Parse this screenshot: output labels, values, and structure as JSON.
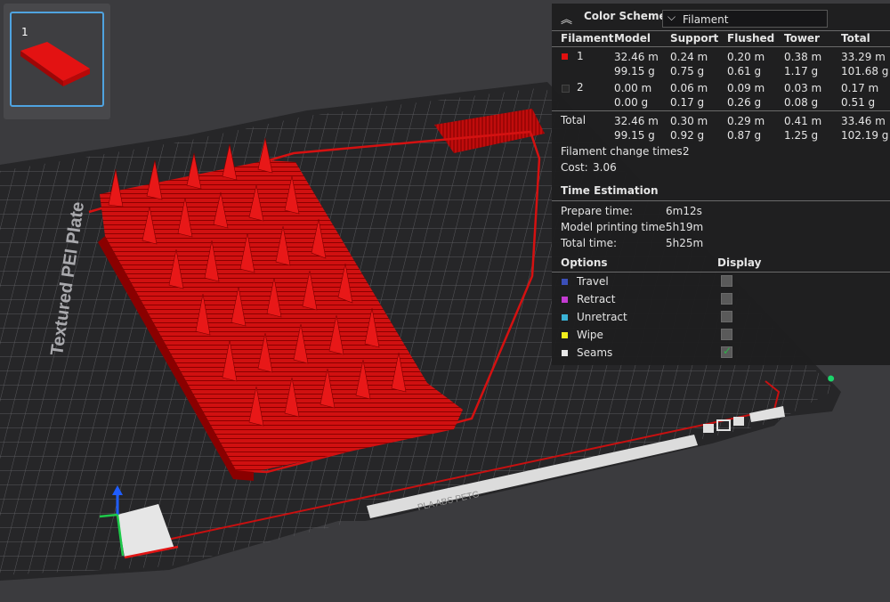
{
  "plate": {
    "label": "Textured PEI Plate",
    "bottom_label": "PLA ABS PETG"
  },
  "thumbnail": {
    "number": "1"
  },
  "panel": {
    "color_scheme_label": "Color Scheme",
    "color_scheme_value": "Filament",
    "columns": [
      "Filament",
      "Model",
      "Support",
      "Flushed",
      "Tower",
      "Total"
    ],
    "rows": [
      {
        "id": "1",
        "color": "#e11010",
        "model": [
          "32.46 m",
          "99.15 g"
        ],
        "support": [
          "0.24 m",
          "0.75 g"
        ],
        "flushed": [
          "0.20 m",
          "0.61 g"
        ],
        "tower": [
          "0.38 m",
          "1.17 g"
        ],
        "total": [
          "33.29 m",
          "101.68 g"
        ]
      },
      {
        "id": "2",
        "color": "#2a2a2a",
        "model": [
          "0.00 m",
          "0.00 g"
        ],
        "support": [
          "0.06 m",
          "0.17 g"
        ],
        "flushed": [
          "0.09 m",
          "0.26 g"
        ],
        "tower": [
          "0.03 m",
          "0.08 g"
        ],
        "total": [
          "0.17 m",
          "0.51 g"
        ]
      }
    ],
    "total_row": {
      "label": "Total",
      "model": [
        "32.46 m",
        "99.15 g"
      ],
      "support": [
        "0.30 m",
        "0.92 g"
      ],
      "flushed": [
        "0.29 m",
        "0.87 g"
      ],
      "tower": [
        "0.41 m",
        "1.25 g"
      ],
      "total": [
        "33.46 m",
        "102.19 g"
      ]
    },
    "filament_change_label": "Filament change times:",
    "filament_change_value": "2",
    "cost_label": "Cost:",
    "cost_value": "3.06",
    "time_estimation_title": "Time Estimation",
    "times": [
      {
        "label": "Prepare time:",
        "value": "6m12s"
      },
      {
        "label": "Model printing time:",
        "value": "5h19m"
      },
      {
        "label": "Total time:",
        "value": "5h25m"
      }
    ],
    "options_header": "Options",
    "display_header": "Display",
    "options": [
      {
        "label": "Travel",
        "color": "#3b4fb8",
        "checked": false
      },
      {
        "label": "Retract",
        "color": "#c43bd2",
        "checked": false
      },
      {
        "label": "Unretract",
        "color": "#3ab2d6",
        "checked": false
      },
      {
        "label": "Wipe",
        "color": "#f2ee1c",
        "checked": false
      },
      {
        "label": "Seams",
        "color": "#e8e8e8",
        "checked": true
      }
    ]
  }
}
